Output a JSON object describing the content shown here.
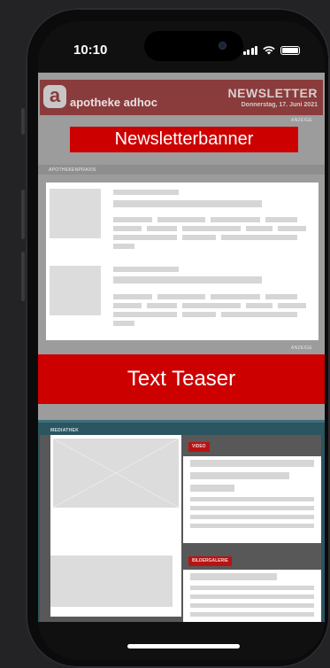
{
  "status_bar": {
    "time": "10:10"
  },
  "newsletter": {
    "logo_letter": "a",
    "brand_name": "apotheke adhoc",
    "title": "NEWSLETTER",
    "date": "Donnerstag, 17. Juni 2021",
    "anzeige_label": "ANZEIGE",
    "banner_text": "Newsletterbanner",
    "section_label": "APOTHEKENPRAXIS",
    "anzeige_label_2": "ANZEIGE",
    "teaser_text": "Text Teaser",
    "media_label": "MEDIATHEK",
    "video_tag": "VIDEO",
    "gallery_tag": "BILDERGALERIE"
  }
}
